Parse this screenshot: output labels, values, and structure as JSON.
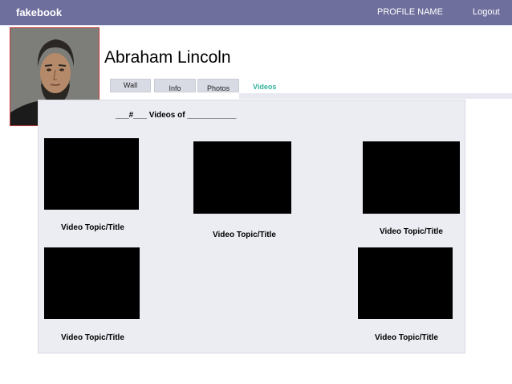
{
  "topbar": {
    "logo": "fakebook",
    "profile_name": "PROFILE NAME",
    "logout": "Logout"
  },
  "profile": {
    "name": "Abraham Lincoln"
  },
  "tabs": {
    "wall": "Wall",
    "info": "Info",
    "photos": "Photos",
    "videos": "Videos"
  },
  "colors": {
    "topbar": "#6f6f9d",
    "active_tab": "#35b39b",
    "panel": "#ecedf3"
  },
  "videos": {
    "heading": "___#___ Videos of ___________",
    "items": [
      {
        "title": "Video Topic/Title"
      },
      {
        "title": "Video Topic/Title"
      },
      {
        "title": "Video Topic/Title"
      },
      {
        "title": "Video Topic/Title"
      },
      {
        "title": "Video Topic/Title"
      }
    ]
  }
}
